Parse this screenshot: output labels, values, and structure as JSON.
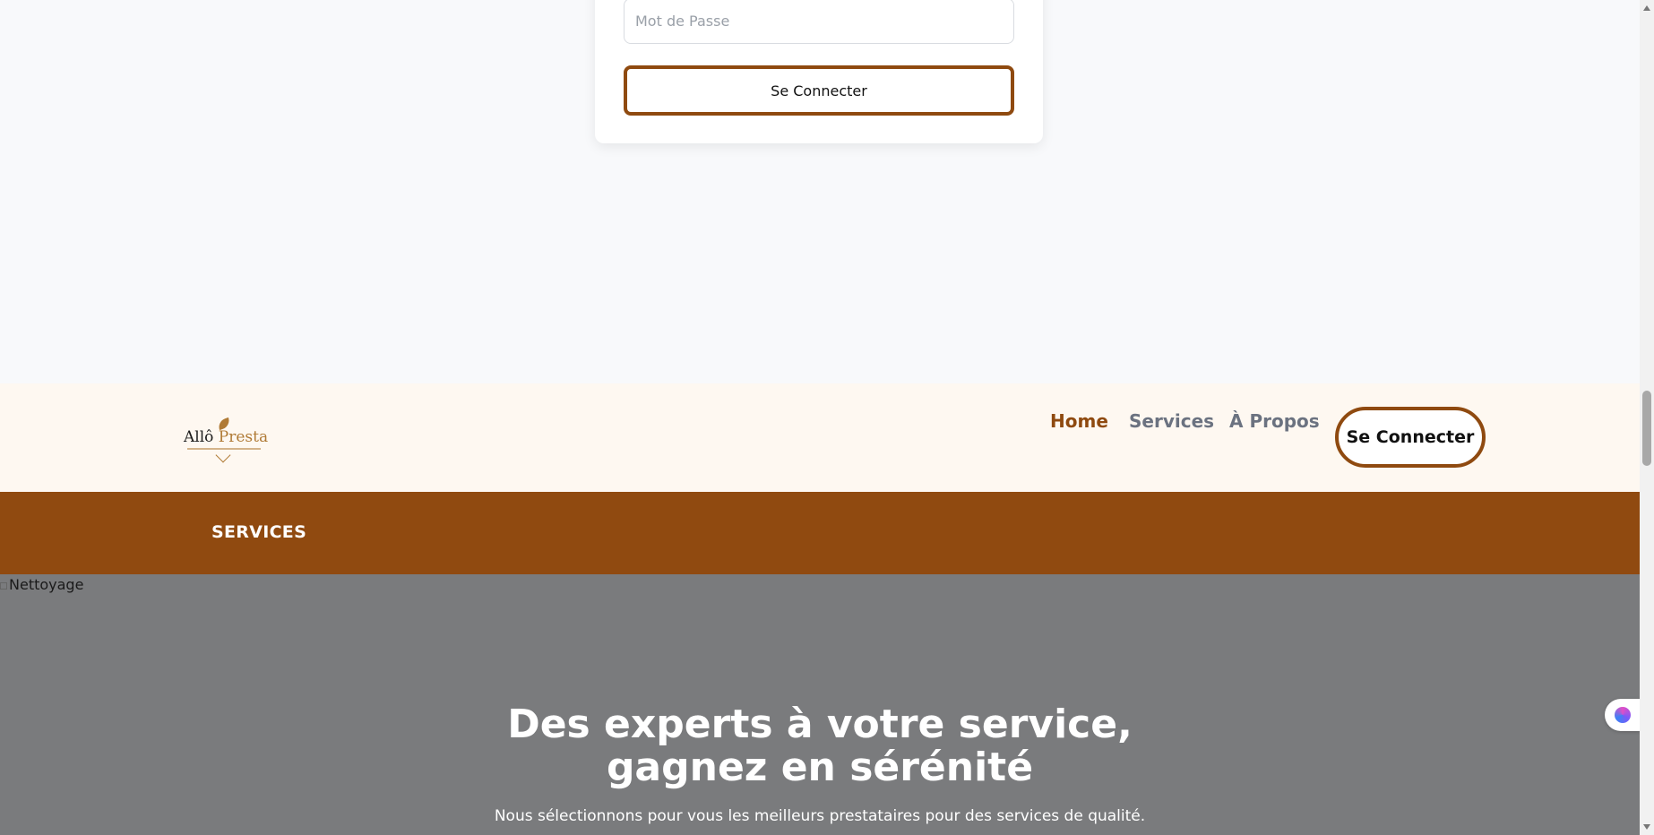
{
  "login_card": {
    "password_placeholder": "Mot de Passe",
    "submit_label": "Se Connecter"
  },
  "header": {
    "logo_text_a": "Allô ",
    "logo_text_b": "Presta",
    "nav": [
      {
        "label": "Home",
        "active": true
      },
      {
        "label": "Services",
        "active": false
      },
      {
        "label": "À Propos",
        "active": false
      }
    ],
    "login_label": "Se Connecter"
  },
  "services_band": {
    "title": "SERVICES"
  },
  "hero": {
    "image_alt": "Nettoyage",
    "title_line1": "Des experts à votre service,",
    "title_line2": "gagnez en sérénité",
    "subtitle": "Nous sélectionnons pour vous les meilleurs prestataires pour des services de qualité."
  },
  "colors": {
    "brand": "#904a10",
    "header_bg": "#fef8f1",
    "hero_overlay": "#7a7b7d",
    "nav_inactive": "#6b7280"
  }
}
